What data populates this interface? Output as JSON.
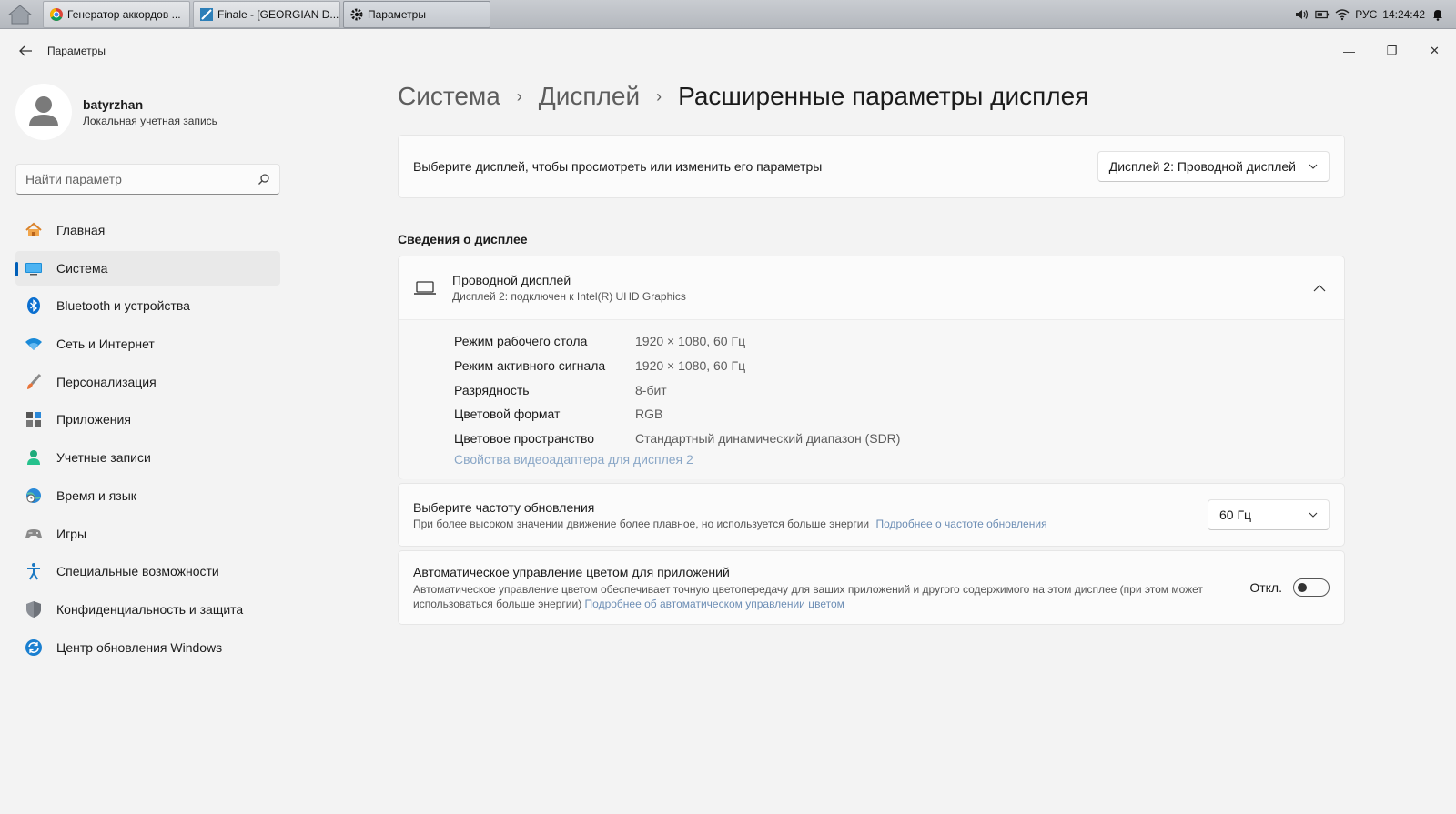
{
  "taskbar": {
    "tabs": [
      {
        "label": "Генератор аккордов ...",
        "icon": "chrome-icon"
      },
      {
        "label": "Finale - [GEORGIAN D...",
        "icon": "finale-icon"
      },
      {
        "label": "Параметры",
        "icon": "gear-icon"
      }
    ],
    "tray": {
      "lang": "РУС",
      "time": "14:24:42"
    }
  },
  "window": {
    "title": "Параметры",
    "controls": {
      "minimize": "—",
      "restore": "❐",
      "close": "✕"
    }
  },
  "profile": {
    "name": "batyrzhan",
    "account_type": "Локальная учетная запись"
  },
  "search": {
    "placeholder": "Найти параметр"
  },
  "nav": {
    "items": [
      {
        "label": "Главная",
        "icon": "home-icon"
      },
      {
        "label": "Система",
        "icon": "system-icon",
        "selected": true
      },
      {
        "label": "Bluetooth и устройства",
        "icon": "bluetooth-icon"
      },
      {
        "label": "Сеть и Интернет",
        "icon": "wifi-icon"
      },
      {
        "label": "Персонализация",
        "icon": "brush-icon"
      },
      {
        "label": "Приложения",
        "icon": "apps-icon"
      },
      {
        "label": "Учетные записи",
        "icon": "account-icon"
      },
      {
        "label": "Время и язык",
        "icon": "globe-clock-icon"
      },
      {
        "label": "Игры",
        "icon": "gamepad-icon"
      },
      {
        "label": "Специальные возможности",
        "icon": "accessibility-icon"
      },
      {
        "label": "Конфиденциальность и защита",
        "icon": "shield-icon"
      },
      {
        "label": "Центр обновления Windows",
        "icon": "update-icon"
      }
    ]
  },
  "breadcrumb": {
    "items": [
      "Система",
      "Дисплей"
    ],
    "current": "Расширенные параметры дисплея"
  },
  "display_select": {
    "label": "Выберите дисплей, чтобы просмотреть или изменить его параметры",
    "value": "Дисплей 2: Проводной дисплей"
  },
  "display_info": {
    "section_title": "Сведения о дисплее",
    "title": "Проводной дисплей",
    "subtitle": "Дисплей 2: подключен к Intel(R) UHD Graphics",
    "rows": [
      {
        "label": "Режим рабочего стола",
        "value": "1920 × 1080, 60 Гц"
      },
      {
        "label": "Режим активного сигнала",
        "value": "1920 × 1080, 60 Гц"
      },
      {
        "label": "Разрядность",
        "value": "8-бит"
      },
      {
        "label": "Цветовой формат",
        "value": "RGB"
      },
      {
        "label": "Цветовое пространство",
        "value": "Стандартный динамический диапазон (SDR)"
      }
    ],
    "adapter_link": "Свойства видеоадаптера для дисплея 2"
  },
  "refresh_rate": {
    "title": "Выберите частоту обновления",
    "description": "При более высоком значении движение более плавное, но используется больше энергии",
    "link": "Подробнее о частоте обновления",
    "value": "60 Гц"
  },
  "auto_color": {
    "title": "Автоматическое управление цветом для приложений",
    "description": "Автоматическое управление цветом обеспечивает точную цветопередачу для ваших приложений и другого содержимого на этом дисплее (при этом может использоваться больше энергии)",
    "link": "Подробнее об автоматическом управлении цветом",
    "state_label": "Откл."
  }
}
